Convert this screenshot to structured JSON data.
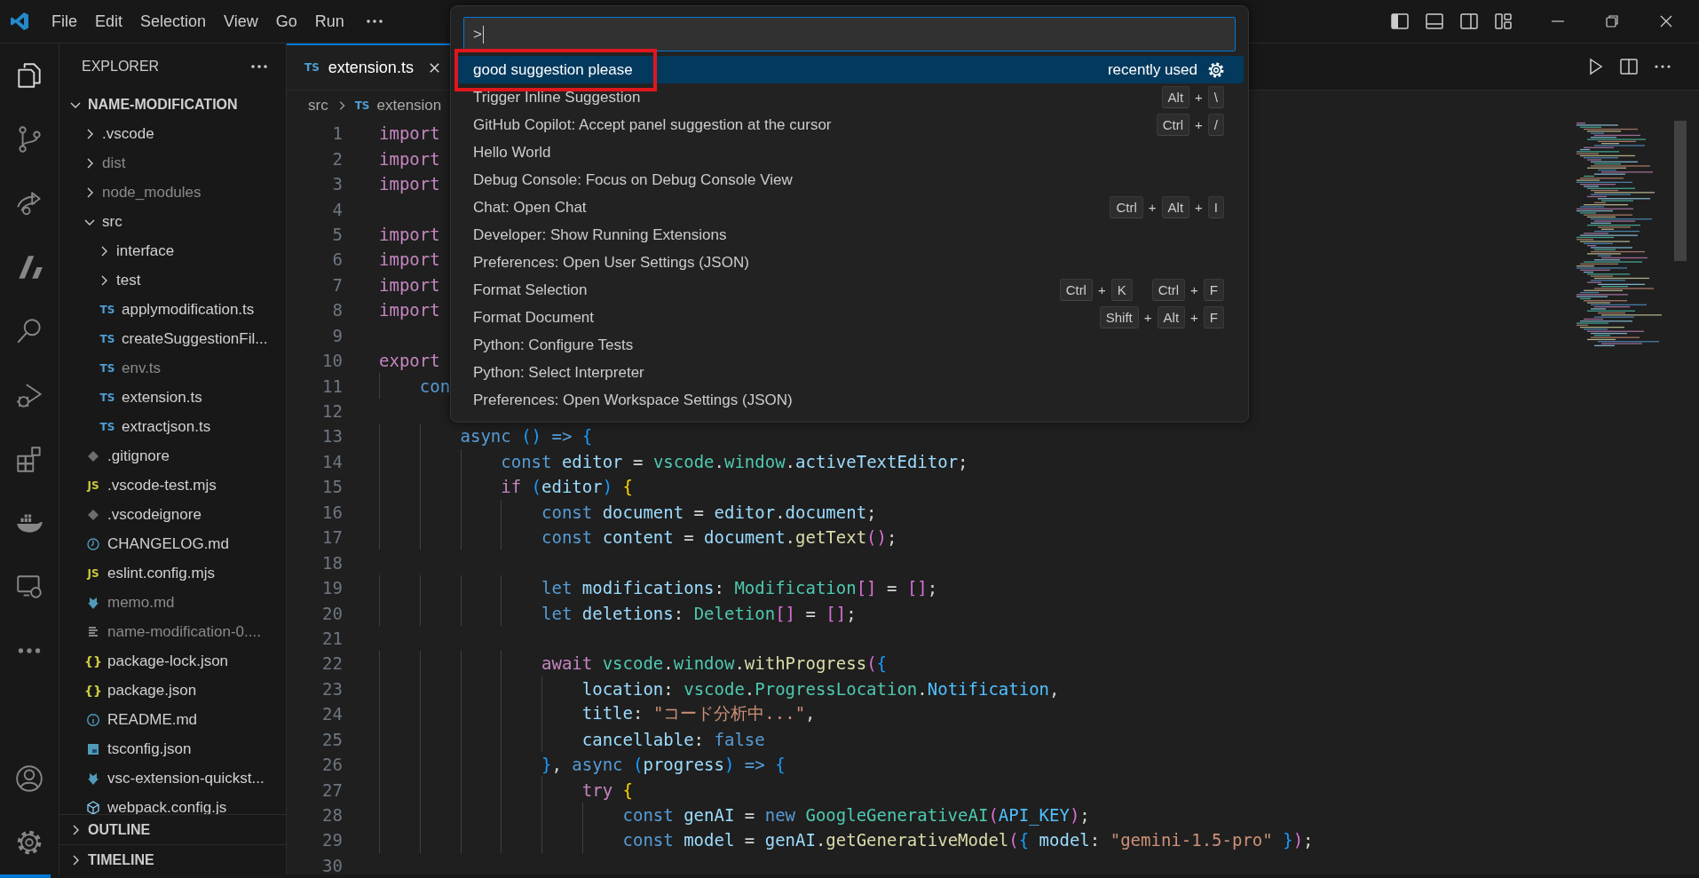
{
  "menu": [
    "File",
    "Edit",
    "Selection",
    "View",
    "Go",
    "Run"
  ],
  "activity_bar": [
    {
      "selected": true
    },
    {
      "selected": false
    },
    {
      "selected": false
    },
    {
      "selected": false
    },
    {
      "selected": false
    },
    {
      "selected": false
    },
    {
      "selected": false
    },
    {
      "selected": false
    },
    {
      "selected": false
    },
    {
      "selected": false
    }
  ],
  "activity_bottom": [
    {
      "selected": false
    },
    {
      "selected": false
    }
  ],
  "explorer": {
    "title": "EXPLORER",
    "tree": [
      {
        "kind": "folder",
        "name": "NAME-MODIFICATION",
        "expanded": true,
        "ignored": false,
        "children": [
          {
            "kind": "folder",
            "name": ".vscode",
            "expanded": false,
            "ignored": false
          },
          {
            "kind": "folder",
            "name": "dist",
            "expanded": false,
            "ignored": true
          },
          {
            "kind": "folder",
            "name": "node_modules",
            "expanded": false,
            "ignored": true
          },
          {
            "kind": "folder",
            "name": "src",
            "expanded": true,
            "ignored": false,
            "children": [
              {
                "kind": "folder",
                "name": "interface",
                "expanded": false,
                "ignored": false
              },
              {
                "kind": "folder",
                "name": "test",
                "expanded": false,
                "ignored": false
              },
              {
                "kind": "ts",
                "badge": "TS",
                "name": "applymodification.ts",
                "ignored": false
              },
              {
                "kind": "ts",
                "badge": "TS",
                "name": "createSuggestionFil...",
                "ignored": false
              },
              {
                "kind": "ts",
                "badge": "TS",
                "name": "env.ts",
                "ignored": true
              },
              {
                "kind": "ts",
                "badge": "TS",
                "name": "extension.ts",
                "ignored": false
              },
              {
                "kind": "ts",
                "badge": "TS",
                "name": "extractjson.ts",
                "ignored": false
              }
            ]
          },
          {
            "kind": "git",
            "name": ".gitignore",
            "ignored": false
          },
          {
            "kind": "js",
            "badge": "JS",
            "name": ".vscode-test.mjs",
            "ignored": false
          },
          {
            "kind": "git",
            "name": ".vscodeignore",
            "ignored": false
          },
          {
            "kind": "changelog",
            "name": "CHANGELOG.md",
            "ignored": false
          },
          {
            "kind": "js",
            "badge": "JS",
            "name": "eslint.config.mjs",
            "ignored": false
          },
          {
            "kind": "download",
            "name": "memo.md",
            "ignored": true
          },
          {
            "kind": "lines",
            "name": "name-modification-0....",
            "ignored": true
          },
          {
            "kind": "json",
            "badge": "{}",
            "name": "package-lock.json",
            "ignored": false
          },
          {
            "kind": "json",
            "badge": "{}",
            "name": "package.json",
            "ignored": false
          },
          {
            "kind": "info",
            "name": "README.md",
            "ignored": false
          },
          {
            "kind": "tsconfig",
            "name": "tsconfig.json",
            "ignored": false
          },
          {
            "kind": "download",
            "name": "vsc-extension-quickst...",
            "ignored": false
          },
          {
            "kind": "webpack",
            "name": "webpack.config.js",
            "ignored": false
          }
        ]
      }
    ],
    "sections": [
      {
        "title": "OUTLINE",
        "expanded": false
      },
      {
        "title": "TIMELINE",
        "expanded": false
      }
    ]
  },
  "tab": {
    "badge": "TS",
    "label": "extension.ts",
    "selected": true
  },
  "breadcrumb": [
    {
      "text": "src"
    },
    {
      "badge": "TS",
      "text": "extension"
    }
  ],
  "code": [
    {
      "n": "1",
      "tokens": [
        {
          "kind": "ctl",
          "text": "import"
        }
      ]
    },
    {
      "n": "2",
      "tokens": [
        {
          "kind": "ctl",
          "text": "import"
        }
      ]
    },
    {
      "n": "3",
      "tokens": [
        {
          "kind": "ctl",
          "text": "import"
        }
      ]
    },
    {
      "n": "4"
    },
    {
      "n": "5",
      "tokens": [
        {
          "kind": "ctl",
          "text": "import"
        }
      ]
    },
    {
      "n": "6",
      "tokens": [
        {
          "kind": "ctl",
          "text": "import"
        }
      ]
    },
    {
      "n": "7",
      "tokens": [
        {
          "kind": "ctl",
          "text": "import"
        }
      ]
    },
    {
      "n": "8",
      "tokens": [
        {
          "kind": "ctl",
          "text": "import"
        }
      ]
    },
    {
      "n": "9"
    },
    {
      "n": "10",
      "tokens": [
        {
          "kind": "ctl",
          "text": "export"
        }
      ]
    },
    {
      "n": "11",
      "tokens": [
        {
          "kind": "kw",
          "text": "    con"
        }
      ]
    },
    {
      "n": "12"
    },
    {
      "n": "13",
      "tokens": [
        {
          "kind": "kw",
          "text": "        async"
        },
        {
          "kind": "b3",
          "text": " ()"
        },
        {
          "kind": "kw",
          "text": " =>"
        },
        {
          "kind": "b3",
          "text": " {"
        }
      ]
    },
    {
      "n": "14",
      "tokens": [
        {
          "kind": "kw",
          "text": "            const"
        },
        {
          "kind": "var",
          "text": " editor"
        },
        {
          "kind": "op",
          "text": " = "
        },
        {
          "kind": "type",
          "text": "vscode"
        },
        {
          "kind": "op",
          "text": "."
        },
        {
          "kind": "type",
          "text": "window"
        },
        {
          "kind": "op",
          "text": "."
        },
        {
          "kind": "var",
          "text": "activeTextEditor"
        },
        {
          "kind": "op",
          "text": ";"
        }
      ]
    },
    {
      "n": "15",
      "tokens": [
        {
          "kind": "ctl",
          "text": "            if"
        },
        {
          "kind": "b3",
          "text": " ("
        },
        {
          "kind": "var",
          "text": "editor"
        },
        {
          "kind": "b3",
          "text": ")"
        },
        {
          "kind": "b1",
          "text": " {"
        }
      ]
    },
    {
      "n": "16",
      "tokens": [
        {
          "kind": "kw",
          "text": "                const"
        },
        {
          "kind": "var",
          "text": " document"
        },
        {
          "kind": "op",
          "text": " = "
        },
        {
          "kind": "var",
          "text": "editor"
        },
        {
          "kind": "op",
          "text": "."
        },
        {
          "kind": "var",
          "text": "document"
        },
        {
          "kind": "op",
          "text": ";"
        }
      ]
    },
    {
      "n": "17",
      "tokens": [
        {
          "kind": "kw",
          "text": "                const"
        },
        {
          "kind": "var",
          "text": " content"
        },
        {
          "kind": "op",
          "text": " = "
        },
        {
          "kind": "var",
          "text": "document"
        },
        {
          "kind": "op",
          "text": "."
        },
        {
          "kind": "fn",
          "text": "getText"
        },
        {
          "kind": "b2",
          "text": "()"
        },
        {
          "kind": "op",
          "text": ";"
        }
      ]
    },
    {
      "n": "18"
    },
    {
      "n": "19",
      "tokens": [
        {
          "kind": "kw",
          "text": "                let"
        },
        {
          "kind": "var",
          "text": " modifications"
        },
        {
          "kind": "op",
          "text": ": "
        },
        {
          "kind": "type",
          "text": "Modification"
        },
        {
          "kind": "b2",
          "text": "[]"
        },
        {
          "kind": "op",
          "text": " = "
        },
        {
          "kind": "b2",
          "text": "[]"
        },
        {
          "kind": "op",
          "text": ";"
        }
      ]
    },
    {
      "n": "20",
      "tokens": [
        {
          "kind": "kw",
          "text": "                let"
        },
        {
          "kind": "var",
          "text": " deletions"
        },
        {
          "kind": "op",
          "text": ": "
        },
        {
          "kind": "type",
          "text": "Deletion"
        },
        {
          "kind": "b2",
          "text": "[]"
        },
        {
          "kind": "op",
          "text": " = "
        },
        {
          "kind": "b2",
          "text": "[]"
        },
        {
          "kind": "op",
          "text": ";"
        }
      ]
    },
    {
      "n": "21"
    },
    {
      "n": "22",
      "tokens": [
        {
          "kind": "ctl",
          "text": "                await"
        },
        {
          "kind": "type",
          "text": " vscode"
        },
        {
          "kind": "op",
          "text": "."
        },
        {
          "kind": "type",
          "text": "window"
        },
        {
          "kind": "op",
          "text": "."
        },
        {
          "kind": "fn",
          "text": "withProgress"
        },
        {
          "kind": "b2",
          "text": "("
        },
        {
          "kind": "b3",
          "text": "{"
        }
      ]
    },
    {
      "n": "23",
      "tokens": [
        {
          "kind": "var",
          "text": "                    location"
        },
        {
          "kind": "op",
          "text": ": "
        },
        {
          "kind": "type",
          "text": "vscode"
        },
        {
          "kind": "op",
          "text": "."
        },
        {
          "kind": "type",
          "text": "ProgressLocation"
        },
        {
          "kind": "op",
          "text": "."
        },
        {
          "kind": "const",
          "text": "Notification"
        },
        {
          "kind": "op",
          "text": ","
        }
      ]
    },
    {
      "n": "24",
      "tokens": [
        {
          "kind": "var",
          "text": "                    title"
        },
        {
          "kind": "op",
          "text": ": "
        },
        {
          "kind": "str",
          "text": "\"コード分析中...\""
        },
        {
          "kind": "op",
          "text": ","
        }
      ]
    },
    {
      "n": "25",
      "tokens": [
        {
          "kind": "var",
          "text": "                    cancellable"
        },
        {
          "kind": "op",
          "text": ": "
        },
        {
          "kind": "kw",
          "text": "false"
        }
      ]
    },
    {
      "n": "26",
      "tokens": [
        {
          "kind": "b3",
          "text": "                }"
        },
        {
          "kind": "op",
          "text": ", "
        },
        {
          "kind": "kw",
          "text": "async"
        },
        {
          "kind": "b3",
          "text": " ("
        },
        {
          "kind": "var",
          "text": "progress"
        },
        {
          "kind": "b3",
          "text": ")"
        },
        {
          "kind": "kw",
          "text": " =>"
        },
        {
          "kind": "b3",
          "text": " {"
        }
      ]
    },
    {
      "n": "27",
      "tokens": [
        {
          "kind": "ctl",
          "text": "                    try"
        },
        {
          "kind": "b1",
          "text": " {"
        }
      ]
    },
    {
      "n": "28",
      "tokens": [
        {
          "kind": "kw",
          "text": "                        const"
        },
        {
          "kind": "var",
          "text": " genAI"
        },
        {
          "kind": "op",
          "text": " = "
        },
        {
          "kind": "kw",
          "text": "new"
        },
        {
          "kind": "type",
          "text": " GoogleGenerativeAI"
        },
        {
          "kind": "b2",
          "text": "("
        },
        {
          "kind": "const",
          "text": "API_KEY"
        },
        {
          "kind": "b2",
          "text": ")"
        },
        {
          "kind": "op",
          "text": ";"
        }
      ]
    },
    {
      "n": "29",
      "tokens": [
        {
          "kind": "kw",
          "text": "                        const"
        },
        {
          "kind": "var",
          "text": " model"
        },
        {
          "kind": "op",
          "text": " = "
        },
        {
          "kind": "var",
          "text": "genAI"
        },
        {
          "kind": "op",
          "text": "."
        },
        {
          "kind": "fn",
          "text": "getGenerativeModel"
        },
        {
          "kind": "b2",
          "text": "("
        },
        {
          "kind": "b3",
          "text": "{"
        },
        {
          "kind": "var",
          "text": " model"
        },
        {
          "kind": "op",
          "text": ": "
        },
        {
          "kind": "str",
          "text": "\"gemini-1.5-pro\""
        },
        {
          "kind": "b3",
          "text": " }"
        },
        {
          "kind": "b2",
          "text": ")"
        },
        {
          "kind": "op",
          "text": ";"
        }
      ]
    },
    {
      "n": "30"
    }
  ],
  "palette": {
    "value": ">",
    "items": [
      {
        "label": "good suggestion please",
        "selected": true,
        "outlined": true,
        "note": "recently used",
        "gear": true
      },
      {
        "label": "Trigger Inline Suggestion",
        "selected": false,
        "outlined": false,
        "keys": [
          {
            "kind": "key",
            "text": "Alt"
          },
          {
            "kind": "plus",
            "text": "+"
          },
          {
            "kind": "key",
            "text": "\\"
          }
        ]
      },
      {
        "label": "GitHub Copilot: Accept panel suggestion at the cursor",
        "selected": false,
        "outlined": false,
        "keys": [
          {
            "kind": "key",
            "text": "Ctrl"
          },
          {
            "kind": "plus",
            "text": "+"
          },
          {
            "kind": "key",
            "text": "/"
          }
        ]
      },
      {
        "label": "Hello World",
        "selected": false,
        "outlined": false
      },
      {
        "label": "Debug Console: Focus on Debug Console View",
        "selected": false,
        "outlined": false
      },
      {
        "label": "Chat: Open Chat",
        "selected": false,
        "outlined": false,
        "keys": [
          {
            "kind": "key",
            "text": "Ctrl"
          },
          {
            "kind": "plus",
            "text": "+"
          },
          {
            "kind": "key",
            "text": "Alt"
          },
          {
            "kind": "plus",
            "text": "+"
          },
          {
            "kind": "key",
            "text": "I"
          }
        ]
      },
      {
        "label": "Developer: Show Running Extensions",
        "selected": false,
        "outlined": false
      },
      {
        "label": "Preferences: Open User Settings (JSON)",
        "selected": false,
        "outlined": false
      },
      {
        "label": "Format Selection",
        "selected": false,
        "outlined": false,
        "keys": [
          {
            "kind": "key",
            "text": "Ctrl"
          },
          {
            "kind": "plus",
            "text": "+"
          },
          {
            "kind": "key",
            "text": "K"
          },
          {
            "kind": "space"
          },
          {
            "kind": "key",
            "text": "Ctrl"
          },
          {
            "kind": "plus",
            "text": "+"
          },
          {
            "kind": "key",
            "text": "F"
          }
        ]
      },
      {
        "label": "Format Document",
        "selected": false,
        "outlined": false,
        "keys": [
          {
            "kind": "key",
            "text": "Shift"
          },
          {
            "kind": "plus",
            "text": "+"
          },
          {
            "kind": "key",
            "text": "Alt"
          },
          {
            "kind": "plus",
            "text": "+"
          },
          {
            "kind": "key",
            "text": "F"
          }
        ]
      },
      {
        "label": "Python: Configure Tests",
        "selected": false,
        "outlined": false
      },
      {
        "label": "Python: Select Interpreter",
        "selected": false,
        "outlined": false
      },
      {
        "label": "Preferences: Open Workspace Settings (JSON)",
        "selected": false,
        "outlined": false
      }
    ]
  }
}
